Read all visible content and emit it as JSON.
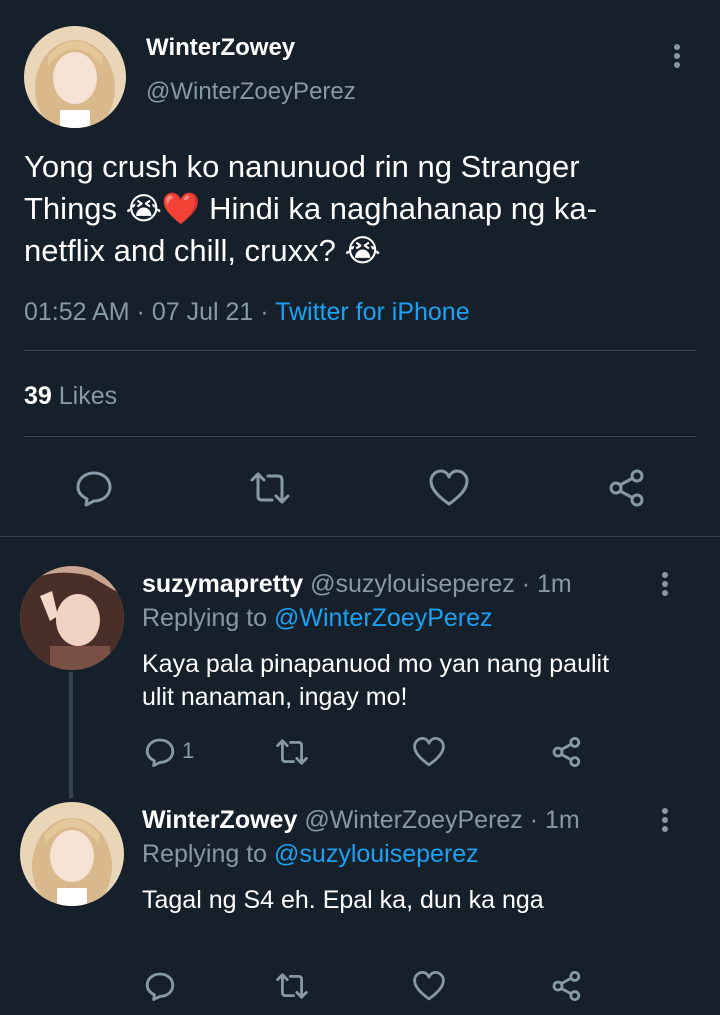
{
  "main_tweet": {
    "display_name": "WinterZowey",
    "handle": "@WinterZoeyPerez",
    "text_line1": "Yong crush ko nanunuod rin ng Stranger",
    "text_line2a": "Things ",
    "emoji_cry": "😭",
    "emoji_heart": "❤️",
    "text_line2b": " Hindi ka naghahanap ng ka-",
    "text_line3": "netflix and chill, cruxx? ",
    "time": "01:52 AM · 07 Jul 21 · ",
    "source": "Twitter for iPhone",
    "likes_count": "39",
    "likes_label": "Likes"
  },
  "reply1": {
    "display_name": "suzymapretty",
    "meta": "@suzylouiseperez · 1m",
    "replying_label": "Replying to ",
    "replying_handle": "@WinterZoeyPerez",
    "text_line1": "Kaya pala pinapanuod mo yan nang paulit",
    "text_line2": "ulit nanaman, ingay mo!",
    "reply_count": "1"
  },
  "reply2": {
    "display_name": "WinterZowey",
    "meta": "@WinterZoeyPerez · 1m",
    "replying_label": "Replying to ",
    "replying_handle": "@suzylouiseperez",
    "text_line1": "Tagal ng S4 eh. Epal ka, dun ka nga"
  },
  "colors": {
    "background": "#15202b",
    "secondary_text": "#8899a6",
    "link": "#1da1f2",
    "heart": "#e0245e"
  },
  "icons": [
    "more-icon",
    "reply-icon",
    "retweet-icon",
    "like-icon",
    "share-icon"
  ]
}
